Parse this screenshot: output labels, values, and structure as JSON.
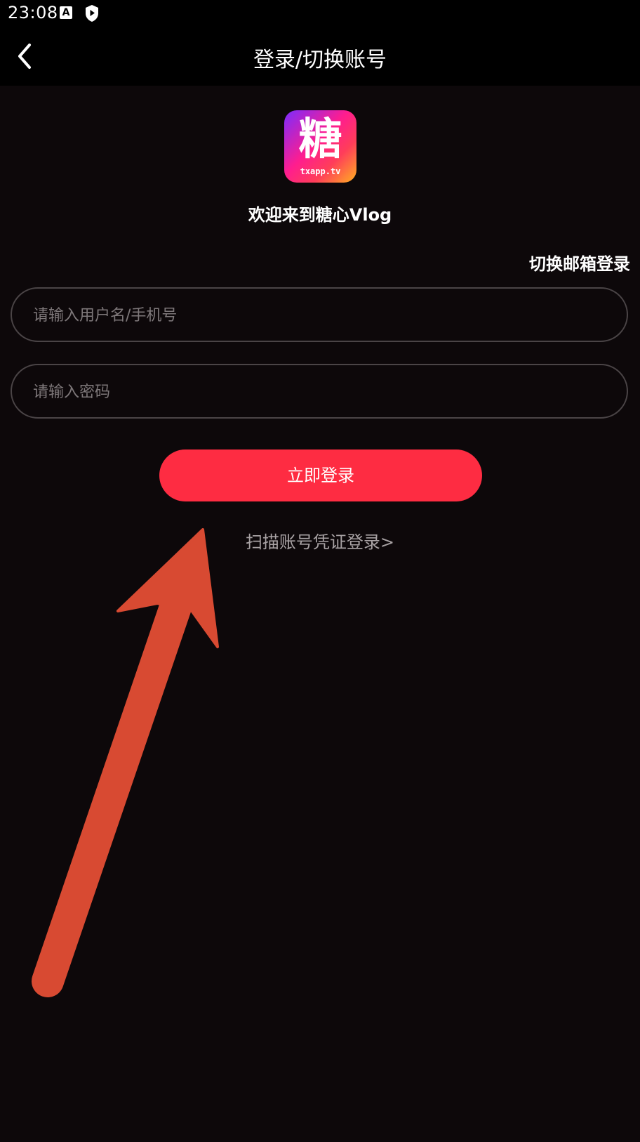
{
  "status_bar": {
    "time": "23:08",
    "icons": [
      "a-notification-icon",
      "shield-play-icon"
    ]
  },
  "header": {
    "title": "登录/切换账号",
    "back_icon": "chevron-left-icon"
  },
  "logo": {
    "char": "糖",
    "text": "txapp.tv"
  },
  "welcome": "欢迎来到糖心Vlog",
  "switch_email": "切换邮箱登录",
  "form": {
    "username_placeholder": "请输入用户名/手机号",
    "password_placeholder": "请输入密码",
    "login_label": "立即登录"
  },
  "scan_login": "扫描账号凭证登录>",
  "colors": {
    "background": "#0d080a",
    "accent": "#fe2c42",
    "annotation_arrow": "#d84a32"
  }
}
